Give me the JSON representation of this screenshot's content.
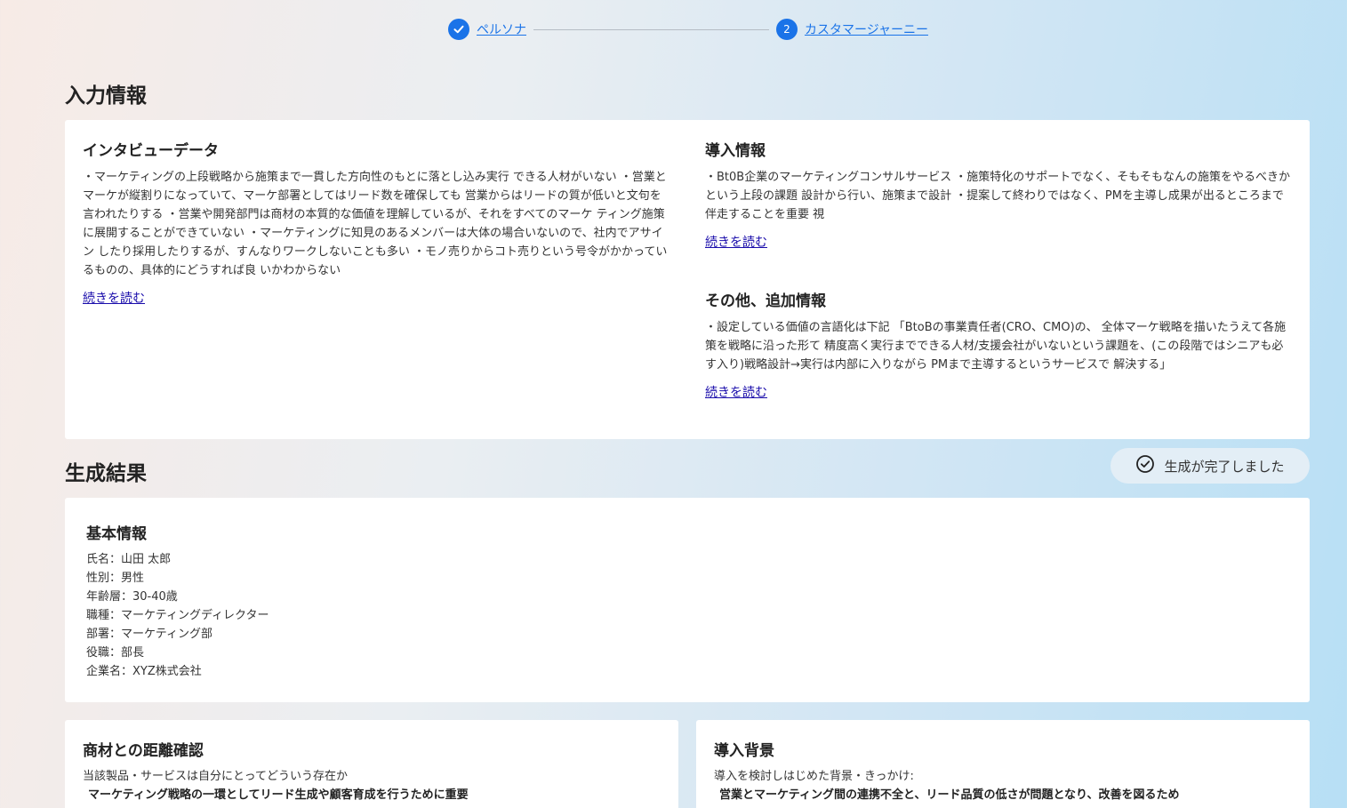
{
  "stepper": {
    "step1_label": "ペルソナ",
    "step2_number": "2",
    "step2_label": "カスタマージャーニー"
  },
  "input_section": {
    "title": "入力情報",
    "interview": {
      "heading": "インタビューデータ",
      "body": "・マーケティングの上段戦略から施策まで一貫した方向性のもとに落とし込み実行 できる人材がいない ・営業とマーケが縦割りになっていて、マーケ部署としてはリード数を確保しても 営業からはリードの質が低いと文句を言われたりする ・営業や開発部門は商材の本質的な価値を理解しているが、それをすべてのマーケ ティング施策に展開することができていない ・マーケティングに知見のあるメンバーは大体の場合いないので、社内でアサイン したり採用したりするが、すんなりワークしないことも多い ・モノ売りからコト売りという号令がかかっているものの、具体的にどうすれば良 いかわからない",
      "read_more": "続きを読む"
    },
    "intro": {
      "heading": "導入情報",
      "body": "・Bt0B企業のマーケティングコンサルサービス ・施策特化のサポートでなく、そもそもなんの施策をやるべきかという上段の課題 設計から行い、施策まで設計 ・提案して終わりではなく、PMを主導し成果が出るところまで伴走することを重要 視",
      "read_more": "続きを読む"
    },
    "other": {
      "heading": "その他、追加情報",
      "body": "・設定している価値の言語化は下記 「BtoBの事業責任者(CRO、CMO)の、 全体マーケ戦略を描いたうえて各施策を戦略に沿った形て 精度高く実行までできる人材/支援会社がいないという課題を、(この段階ではシニアも必す入り)戦略設計→実行は内部に入りながら PMまで主導するというサービスで 解決する」",
      "read_more": "続きを読む"
    }
  },
  "result_section": {
    "title": "生成結果",
    "status": "生成が完了しました",
    "basic": {
      "heading": "基本情報",
      "lines": [
        "氏名：山田 太郎",
        "性別：男性",
        "年齢層：30-40歳",
        "職種：マーケティングディレクター",
        "部署：マーケティング部",
        "役職：部長",
        "企業名：XYZ株式会社"
      ]
    },
    "distance": {
      "heading": "商材との距離確認",
      "question": "当該製品・サービスは自分にとってどういう存在か",
      "answer": "マーケティング戦略の一環としてリード生成や顧客育成を行うために重要"
    },
    "background": {
      "heading": "導入背景",
      "question": "導入を検討しはじめた背景・きっかけ:",
      "answer": "営業とマーケティング間の連携不全と、リード品質の低さが問題となり、改善を図るため"
    }
  }
}
